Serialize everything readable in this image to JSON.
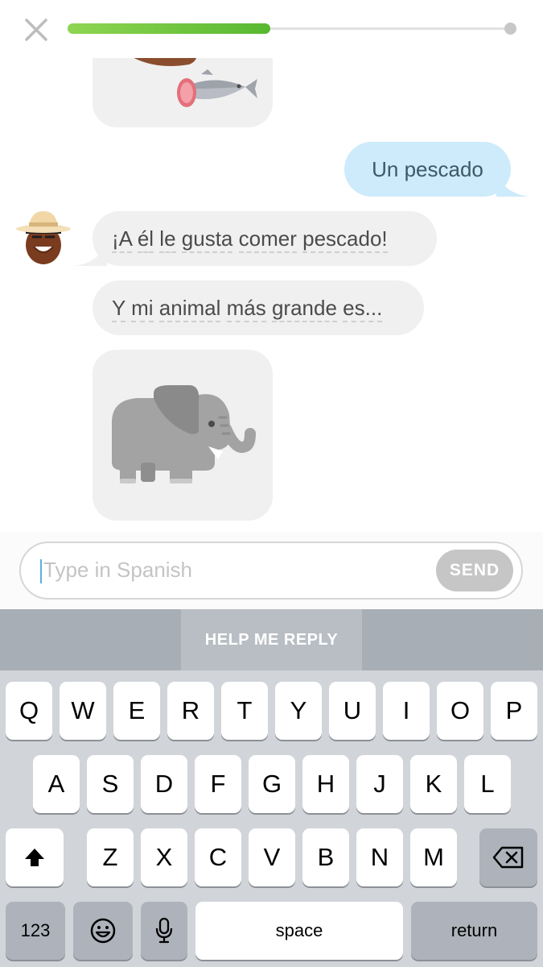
{
  "progress": {
    "fraction": 0.46
  },
  "chat": {
    "user_reply": "Un pescado",
    "bot_message_1": [
      "¡A",
      "él",
      "le",
      "gusta",
      "comer",
      "pescado!"
    ],
    "bot_message_2": [
      "Y",
      "mi",
      "animal",
      "más",
      "grande",
      "es..."
    ]
  },
  "input": {
    "placeholder": "Type in Spanish",
    "send_label": "SEND"
  },
  "help": {
    "label": "HELP ME REPLY"
  },
  "keyboard": {
    "row1": [
      "Q",
      "W",
      "E",
      "R",
      "T",
      "Y",
      "U",
      "I",
      "O",
      "P"
    ],
    "row2": [
      "A",
      "S",
      "D",
      "F",
      "G",
      "H",
      "J",
      "K",
      "L"
    ],
    "row3": [
      "Z",
      "X",
      "C",
      "V",
      "B",
      "N",
      "M"
    ],
    "numbers_label": "123",
    "space_label": "space",
    "return_label": "return"
  },
  "icons": {
    "close": "close-icon",
    "shift": "shift-icon",
    "backspace": "backspace-icon",
    "emoji": "emoji-icon",
    "mic": "microphone-icon"
  }
}
